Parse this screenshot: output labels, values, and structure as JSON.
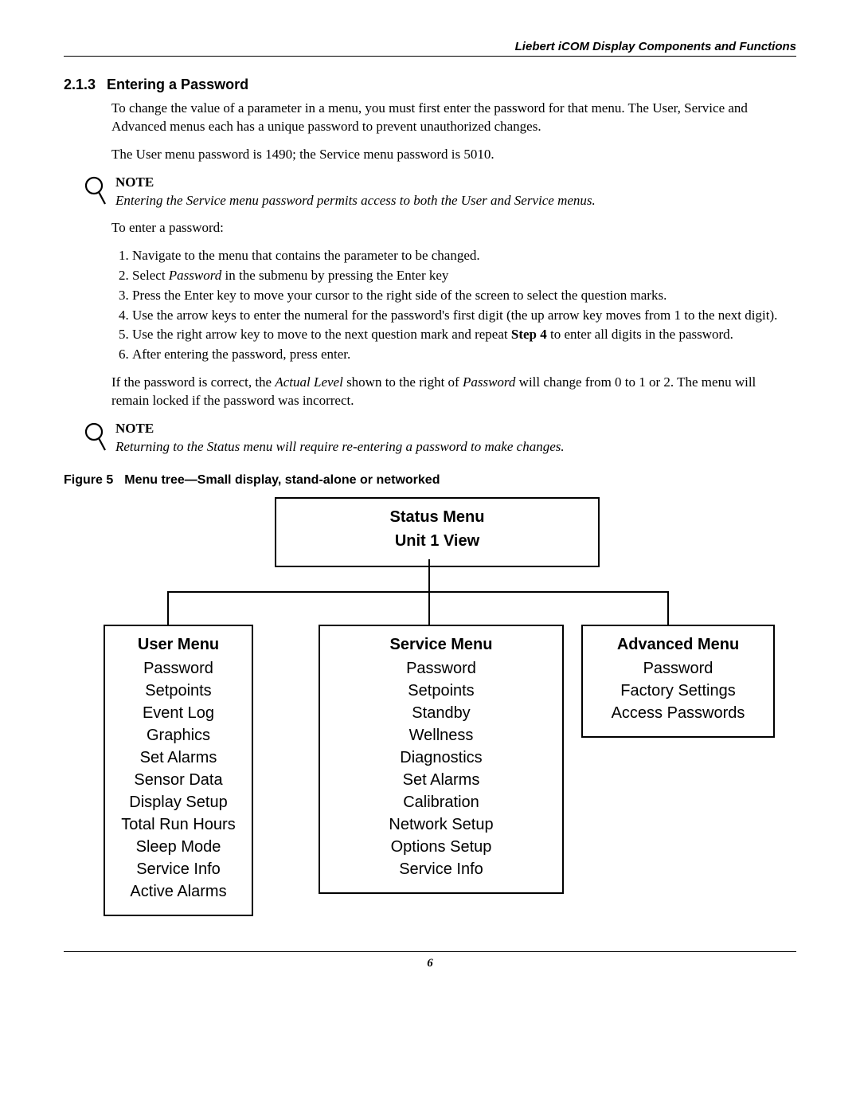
{
  "header": "Liebert iCOM Display Components and Functions",
  "section": {
    "num": "2.1.3",
    "title": "Entering a Password",
    "para1": "To change the value of a parameter in a menu, you must first enter the password for that menu. The User, Service and Advanced menus each has a unique password to prevent unauthorized changes.",
    "para2": "The User menu password is 1490; the Service menu password is 5010."
  },
  "note1": {
    "label": "NOTE",
    "text": "Entering the Service menu password permits access to both the User and Service menus."
  },
  "to_enter": "To enter a password:",
  "steps": [
    "Navigate to the menu that contains the parameter to be changed.",
    "Select Password in the submenu by pressing the Enter key",
    "Press the Enter key to move your cursor to the right side of the screen to select the question marks.",
    "Use the arrow keys to enter the numeral for the password's first digit (the up arrow key moves from 1 to the next digit).",
    "Use the right arrow key to move to the next question mark and repeat Step 4 to enter all digits in the password.",
    "After entering the password, press enter."
  ],
  "after_steps": "If the password is correct, the Actual Level shown to the right of Password will change from 0 to 1 or 2. The menu will remain locked if the password was incorrect.",
  "note2": {
    "label": "NOTE",
    "text": "Returning to the Status menu will require re-entering a password to make changes."
  },
  "figure": {
    "label": "Figure 5",
    "caption": "Menu tree—Small display, stand-alone or networked"
  },
  "chart_data": {
    "type": "tree",
    "root": {
      "title_line1": "Status Menu",
      "title_line2": "Unit 1 View"
    },
    "children": [
      {
        "title": "User Menu",
        "items": [
          "Password",
          "Setpoints",
          "Event Log",
          "Graphics",
          "Set Alarms",
          "Sensor Data",
          "Display Setup",
          "Total Run Hours",
          "Sleep Mode",
          "Service Info",
          "Active Alarms"
        ]
      },
      {
        "title": "Service Menu",
        "items": [
          "Password",
          "Setpoints",
          "Standby",
          "Wellness",
          "Diagnostics",
          "Set Alarms",
          "Calibration",
          "Network Setup",
          "Options Setup",
          "Service Info"
        ]
      },
      {
        "title": "Advanced Menu",
        "items": [
          "Password",
          "Factory Settings",
          "Access Passwords"
        ]
      }
    ]
  },
  "page_number": "6"
}
